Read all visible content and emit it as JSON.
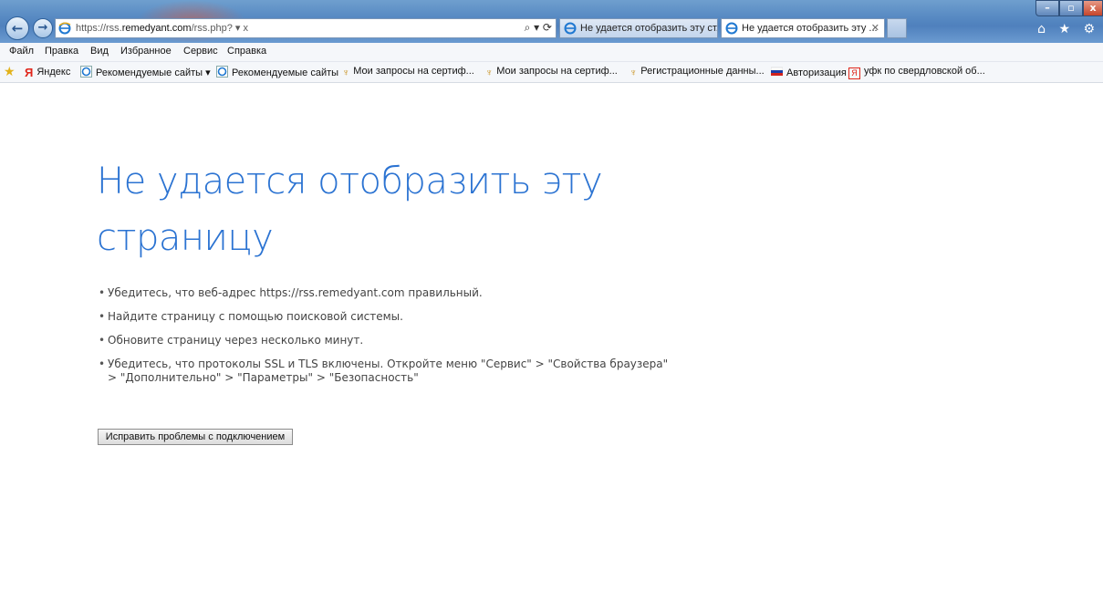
{
  "address_bar": {
    "url_prefix": "https://rss.",
    "url_host": "remedyant.com",
    "url_suffix": "/rss.php? ▾ x",
    "tools": "⌕ ▾ ⟳"
  },
  "tabs": [
    {
      "label": "Не удается отобразить эту ст...",
      "active": false
    },
    {
      "label": "Не удается отобразить эту ...",
      "active": true,
      "close": "✕"
    }
  ],
  "window_controls": {
    "minimize": "–",
    "maximize": "▫",
    "close": "x"
  },
  "right_icons": "⌂ ★ ⚙",
  "menu": [
    "Файл",
    "Правка",
    "Вид",
    "Избранное",
    "Сервис",
    "Справка"
  ],
  "favorites": [
    {
      "label": "Яндекс",
      "icon": "yandex-icon"
    },
    {
      "label": "Рекомендуемые сайты ▾",
      "icon": "ie-icon"
    },
    {
      "label": "Рекомендуемые сайты",
      "icon": "ie-icon"
    },
    {
      "label": "Мои запросы на сертиф...",
      "icon": "eagle-icon"
    },
    {
      "label": "Мои запросы на сертиф...",
      "icon": "eagle-icon"
    },
    {
      "label": "Регистрационные данны...",
      "icon": "eagle-icon"
    },
    {
      "label": "Авторизация",
      "icon": "russia-flag-icon"
    },
    {
      "label": "уфк по свердловской об...",
      "icon": "yandex-box-icon"
    }
  ],
  "content": {
    "heading_line1": "Не удается отобразить эту",
    "heading_line2": "страницу",
    "tips": [
      "Убедитесь, что веб-адрес https://rss.remedyant.com правильный.",
      "Найдите страницу с помощью поисковой системы.",
      "Обновите страницу через несколько минут.",
      "Убедитесь, что протоколы SSL и TLS включены. Откройте меню \"Сервис\" > \"Свойства браузера\""
    ],
    "tip4_line2": "> \"Дополнительно\" > \"Параметры\" > \"Безопасность\"",
    "fix_button": "Исправить проблемы с подключением"
  },
  "colors": {
    "heading": "#2b73d2",
    "chrome": "#5a8cc4"
  }
}
